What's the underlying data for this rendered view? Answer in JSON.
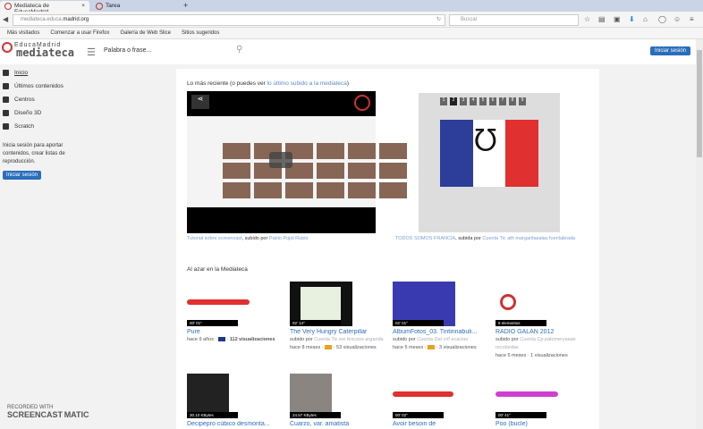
{
  "browser": {
    "tabs": [
      {
        "label": "Mediateca de EducaMadrid"
      },
      {
        "label": "Tarea"
      }
    ],
    "url_prefix": "mediateca.educa.",
    "url_domain": "madrid.org",
    "search_placeholder": "Buscar",
    "bookmarks": [
      "Más visitados",
      "Comenzar a usar Firefox",
      "Galería de Web Slice",
      "Sitios sugeridos"
    ]
  },
  "header": {
    "logo_top": "EducaMadrid",
    "logo_bottom": "mediateca",
    "search_placeholder": "Palabra o frase...",
    "login": "Iniciar sesión"
  },
  "sidebar": {
    "items": [
      {
        "label": "Inicio"
      },
      {
        "label": "Últimos contenidos"
      },
      {
        "label": "Centros"
      },
      {
        "label": "Diseño 3D"
      },
      {
        "label": "Scratch"
      }
    ],
    "prompt": "Inicia sesión para aportar contenidos, crear listas de reproducción.",
    "login": "Iniciar sesión"
  },
  "main": {
    "lead_text": "Lo más reciente (o puedes ver ",
    "lead_link": "lo último subido a la mediateca",
    "lead_end": ")",
    "video_caption": {
      "title": "Tutorial sobre screencast",
      "by": ", subido por ",
      "author": "Pablo Pujol Rubio"
    },
    "slide_pages": [
      "1",
      "2",
      "3",
      "4",
      "5",
      "6",
      "7",
      "8",
      "9"
    ],
    "slide_caption": {
      "title": "TODOS SOMOS FRANCIA",
      "by": ", subida por ",
      "author": "Cuenta Tic ath margaritasalas fuenlabrada"
    },
    "random_title": "Al azar en la Mediateca",
    "items": [
      {
        "badge": "00' 01\"",
        "title": "Pure",
        "meta1": "hace 9 años · ",
        "views": "112 visualizaciones",
        "uploader": ""
      },
      {
        "badge": "02' 14\"",
        "title": "The Very Hungry Caterpillar",
        "uploader": "Cuenta Tic eei fescoos arganda",
        "meta1": "hace 8 meses · ",
        "views": "53 visualizaciones"
      },
      {
        "badge": "02' 01\"",
        "title": "AlbumFotos_03. Tintinnabuli...",
        "uploader": "Cuenta Dat crif acacias",
        "meta1": "hace 5 meses · ",
        "views": "3 visualizaciones"
      },
      {
        "badge": "8 elementos",
        "title": "RADIO GALAN 2012",
        "uploader": "Cuenta Cp palomeryasan recobedas",
        "meta1": "hace 5 meses · ",
        "views": "1 visualizaciones"
      },
      {
        "badge": "30.10 KBytes",
        "title": "Decipepro cúbico desmonta..."
      },
      {
        "badge": "24.57 KBytes",
        "title": "Cuarzo, var. amatista"
      },
      {
        "badge": "00' 02\"",
        "title": "Avoir besoin de"
      },
      {
        "badge": "00' 41\"",
        "title": "Poo (bucle)"
      }
    ],
    "uploaded_by": "subido por "
  },
  "watermark": {
    "line1": "RECORDED WITH",
    "line2": "SCREENCAST",
    "line3": "MATIC"
  },
  "colors": {
    "accent": "#2a6ebb",
    "link": "#5b8ac7"
  }
}
